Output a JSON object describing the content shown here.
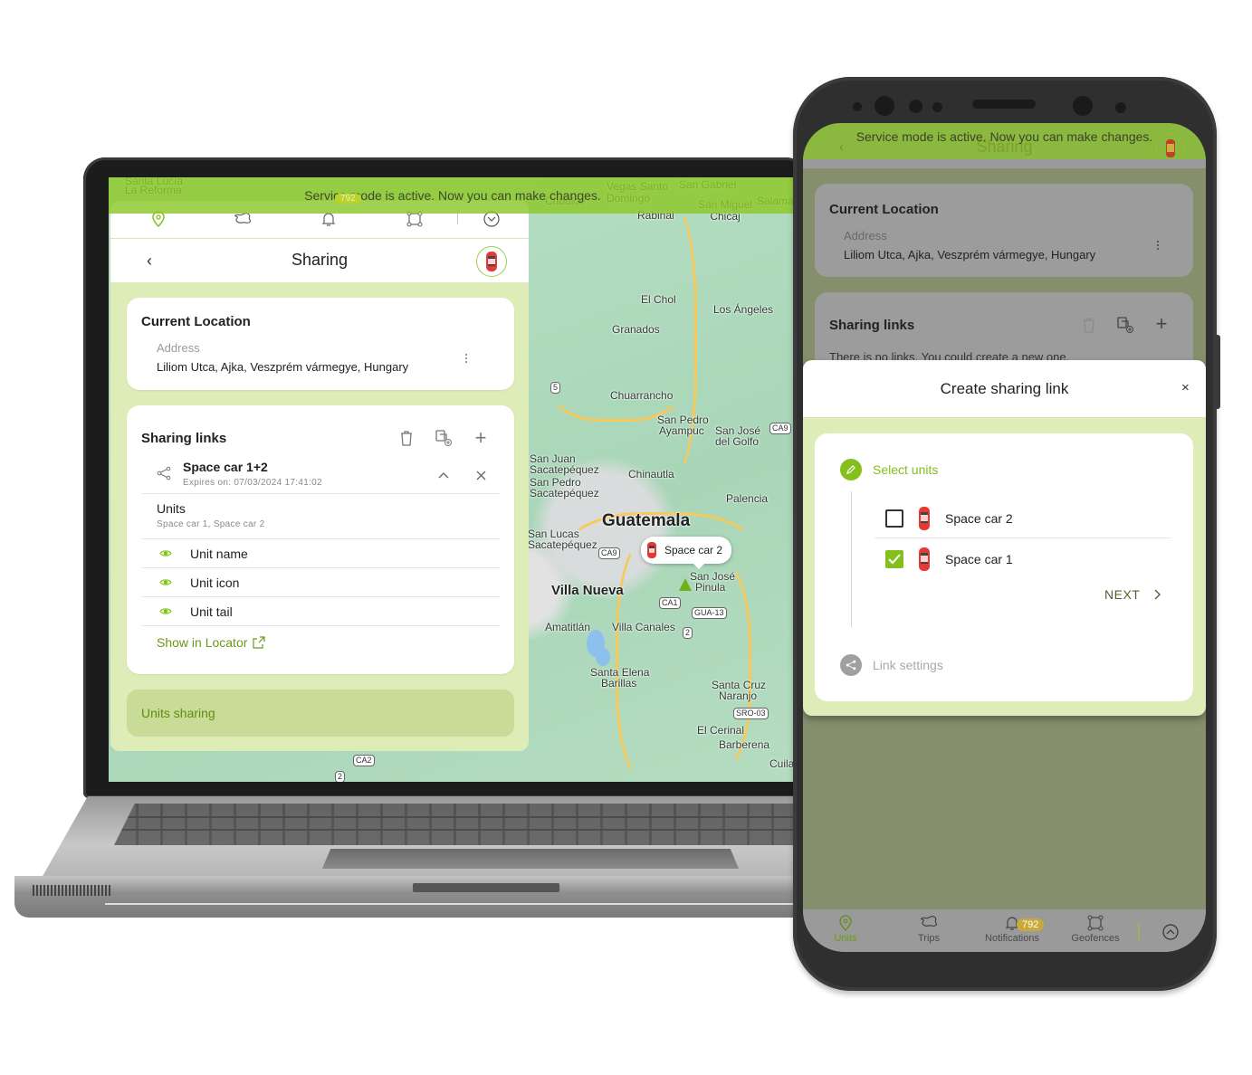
{
  "service_banner": "Service mode is active. Now you can make changes.",
  "colors": {
    "brand_green": "#84bf1c",
    "panel_bg": "#deedb8",
    "badge": "#c8a93a"
  },
  "laptop": {
    "nav_icons": [
      "location-pin-icon",
      "trips-icon",
      "bell-icon",
      "geofence-icon",
      "chevron-down-circle-icon"
    ],
    "nav_badge": "792",
    "header": {
      "back": "‹",
      "title": "Sharing"
    },
    "current_location": {
      "title": "Current Location",
      "address_label": "Address",
      "address_value": "Liliom Utca, Ajka, Veszprém vármegye, Hungary"
    },
    "sharing_links": {
      "title": "Sharing links",
      "link": {
        "name": "Space car 1+2",
        "expires": "Expires on: 07/03/2024 17:41:02",
        "units_label": "Units",
        "units_value": "Space car 1, Space car 2",
        "options": [
          {
            "label": "Unit name",
            "visible": true
          },
          {
            "label": "Unit icon",
            "visible": true
          },
          {
            "label": "Unit tail",
            "visible": true
          }
        ],
        "show_in_locator": "Show in Locator"
      }
    },
    "units_sharing": "Units sharing",
    "map": {
      "labels": [
        "Santa Lucía",
        "La Reforma",
        "Cubulco",
        "Vegas Santo Domingo",
        "San Gabriel",
        "San Miguel Chicaj",
        "Salamá",
        "Rabinal",
        "El Chol",
        "Los Ángeles",
        "Granados",
        "Chuarrancho",
        "San Pedro",
        "Ayampuc",
        "San José",
        "del Golfo",
        "San Juan",
        "Sacatepéquez",
        "San Pedro",
        "Sacatepéquez",
        "Chinautla",
        "Palencia",
        "Guatemala",
        "San Lucas",
        "Sacatepéquez",
        "Villa Nueva",
        "San José",
        "Pinula",
        "Amatitlán",
        "Villa Canales",
        "Santa Elena",
        "Barillas",
        "Santa Cruz",
        "Naranjo",
        "El Cerinal",
        "Barberena",
        "Cuilapa"
      ],
      "shields": [
        "5",
        "CA9",
        "CA9",
        "CA1",
        "GUA-13",
        "2",
        "SRO-03",
        "CA2",
        "2"
      ],
      "marker_label": "Space car 2"
    }
  },
  "phone": {
    "header": {
      "back": "‹",
      "title": "Sharing"
    },
    "current_location": {
      "title": "Current Location",
      "address_label": "Address",
      "address_value": "Liliom Utca, Ajka, Veszprém vármegye, Hungary"
    },
    "sharing_links": {
      "title": "Sharing links",
      "empty_text": "There is no links. You could create a new one."
    },
    "dialog": {
      "title": "Create sharing link",
      "close": "×",
      "step1": "Select units",
      "units": [
        {
          "name": "Space car 2",
          "checked": false
        },
        {
          "name": "Space car 1",
          "checked": true
        }
      ],
      "next": "NEXT",
      "step2": "Link settings"
    },
    "tabs": [
      {
        "label": "Units",
        "active": true
      },
      {
        "label": "Trips",
        "active": false
      },
      {
        "label": "Notifications",
        "active": false,
        "badge": "792"
      },
      {
        "label": "Geofences",
        "active": false
      }
    ]
  }
}
